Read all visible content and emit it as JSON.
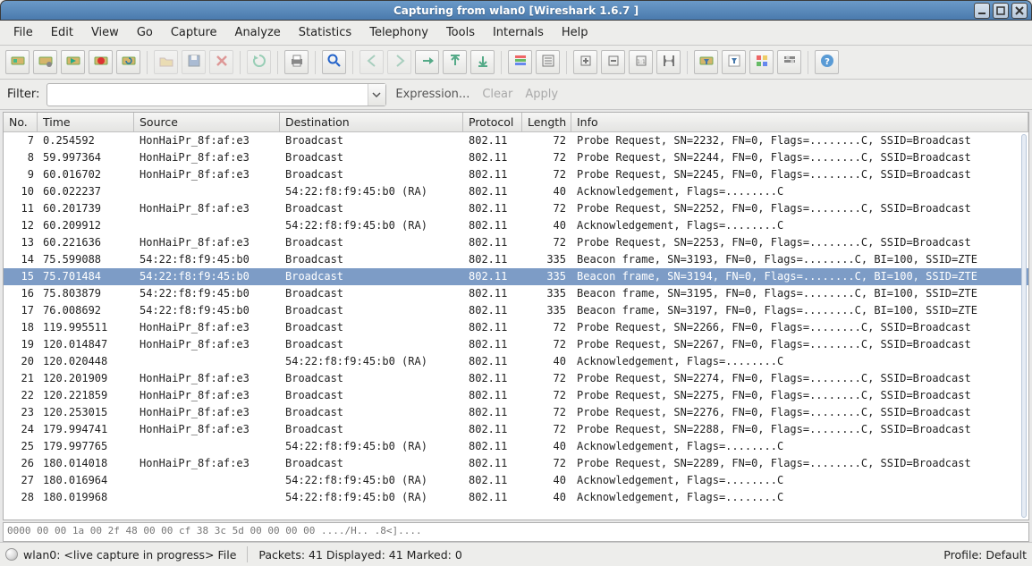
{
  "window_title": "Capturing from wlan0   [Wireshark 1.6.7 ]",
  "menu": {
    "file": "File",
    "edit": "Edit",
    "view": "View",
    "go": "Go",
    "capture": "Capture",
    "analyze": "Analyze",
    "statistics": "Statistics",
    "telephony": "Telephony",
    "tools": "Tools",
    "internals": "Internals",
    "help": "Help"
  },
  "filter": {
    "label": "Filter:",
    "value": "",
    "expression": "Expression...",
    "clear": "Clear",
    "apply": "Apply"
  },
  "columns": {
    "no": "No.",
    "time": "Time",
    "source": "Source",
    "dest": "Destination",
    "proto": "Protocol",
    "len": "Length",
    "info": "Info"
  },
  "selected_no": 15,
  "packets": [
    {
      "no": 7,
      "time": "0.254592",
      "src": "HonHaiPr_8f:af:e3",
      "dst": "Broadcast",
      "proto": "802.11",
      "len": 72,
      "info": "Probe Request, SN=2232, FN=0, Flags=........C, SSID=Broadcast"
    },
    {
      "no": 8,
      "time": "59.997364",
      "src": "HonHaiPr_8f:af:e3",
      "dst": "Broadcast",
      "proto": "802.11",
      "len": 72,
      "info": "Probe Request, SN=2244, FN=0, Flags=........C, SSID=Broadcast"
    },
    {
      "no": 9,
      "time": "60.016702",
      "src": "HonHaiPr_8f:af:e3",
      "dst": "Broadcast",
      "proto": "802.11",
      "len": 72,
      "info": "Probe Request, SN=2245, FN=0, Flags=........C, SSID=Broadcast"
    },
    {
      "no": 10,
      "time": "60.022237",
      "src": "",
      "dst": "54:22:f8:f9:45:b0 (RA)",
      "proto": "802.11",
      "len": 40,
      "info": "Acknowledgement, Flags=........C"
    },
    {
      "no": 11,
      "time": "60.201739",
      "src": "HonHaiPr_8f:af:e3",
      "dst": "Broadcast",
      "proto": "802.11",
      "len": 72,
      "info": "Probe Request, SN=2252, FN=0, Flags=........C, SSID=Broadcast"
    },
    {
      "no": 12,
      "time": "60.209912",
      "src": "",
      "dst": "54:22:f8:f9:45:b0 (RA)",
      "proto": "802.11",
      "len": 40,
      "info": "Acknowledgement, Flags=........C"
    },
    {
      "no": 13,
      "time": "60.221636",
      "src": "HonHaiPr_8f:af:e3",
      "dst": "Broadcast",
      "proto": "802.11",
      "len": 72,
      "info": "Probe Request, SN=2253, FN=0, Flags=........C, SSID=Broadcast"
    },
    {
      "no": 14,
      "time": "75.599088",
      "src": "54:22:f8:f9:45:b0",
      "dst": "Broadcast",
      "proto": "802.11",
      "len": 335,
      "info": "Beacon frame, SN=3193, FN=0, Flags=........C, BI=100, SSID=ZTE"
    },
    {
      "no": 15,
      "time": "75.701484",
      "src": "54:22:f8:f9:45:b0",
      "dst": "Broadcast",
      "proto": "802.11",
      "len": 335,
      "info": "Beacon frame, SN=3194, FN=0, Flags=........C, BI=100, SSID=ZTE"
    },
    {
      "no": 16,
      "time": "75.803879",
      "src": "54:22:f8:f9:45:b0",
      "dst": "Broadcast",
      "proto": "802.11",
      "len": 335,
      "info": "Beacon frame, SN=3195, FN=0, Flags=........C, BI=100, SSID=ZTE"
    },
    {
      "no": 17,
      "time": "76.008692",
      "src": "54:22:f8:f9:45:b0",
      "dst": "Broadcast",
      "proto": "802.11",
      "len": 335,
      "info": "Beacon frame, SN=3197, FN=0, Flags=........C, BI=100, SSID=ZTE"
    },
    {
      "no": 18,
      "time": "119.995511",
      "src": "HonHaiPr_8f:af:e3",
      "dst": "Broadcast",
      "proto": "802.11",
      "len": 72,
      "info": "Probe Request, SN=2266, FN=0, Flags=........C, SSID=Broadcast"
    },
    {
      "no": 19,
      "time": "120.014847",
      "src": "HonHaiPr_8f:af:e3",
      "dst": "Broadcast",
      "proto": "802.11",
      "len": 72,
      "info": "Probe Request, SN=2267, FN=0, Flags=........C, SSID=Broadcast"
    },
    {
      "no": 20,
      "time": "120.020448",
      "src": "",
      "dst": "54:22:f8:f9:45:b0 (RA)",
      "proto": "802.11",
      "len": 40,
      "info": "Acknowledgement, Flags=........C"
    },
    {
      "no": 21,
      "time": "120.201909",
      "src": "HonHaiPr_8f:af:e3",
      "dst": "Broadcast",
      "proto": "802.11",
      "len": 72,
      "info": "Probe Request, SN=2274, FN=0, Flags=........C, SSID=Broadcast"
    },
    {
      "no": 22,
      "time": "120.221859",
      "src": "HonHaiPr_8f:af:e3",
      "dst": "Broadcast",
      "proto": "802.11",
      "len": 72,
      "info": "Probe Request, SN=2275, FN=0, Flags=........C, SSID=Broadcast"
    },
    {
      "no": 23,
      "time": "120.253015",
      "src": "HonHaiPr_8f:af:e3",
      "dst": "Broadcast",
      "proto": "802.11",
      "len": 72,
      "info": "Probe Request, SN=2276, FN=0, Flags=........C, SSID=Broadcast"
    },
    {
      "no": 24,
      "time": "179.994741",
      "src": "HonHaiPr_8f:af:e3",
      "dst": "Broadcast",
      "proto": "802.11",
      "len": 72,
      "info": "Probe Request, SN=2288, FN=0, Flags=........C, SSID=Broadcast"
    },
    {
      "no": 25,
      "time": "179.997765",
      "src": "",
      "dst": "54:22:f8:f9:45:b0 (RA)",
      "proto": "802.11",
      "len": 40,
      "info": "Acknowledgement, Flags=........C"
    },
    {
      "no": 26,
      "time": "180.014018",
      "src": "HonHaiPr_8f:af:e3",
      "dst": "Broadcast",
      "proto": "802.11",
      "len": 72,
      "info": "Probe Request, SN=2289, FN=0, Flags=........C, SSID=Broadcast"
    },
    {
      "no": 27,
      "time": "180.016964",
      "src": "",
      "dst": "54:22:f8:f9:45:b0 (RA)",
      "proto": "802.11",
      "len": 40,
      "info": "Acknowledgement, Flags=........C"
    },
    {
      "no": 28,
      "time": "180.019968",
      "src": "",
      "dst": "54:22:f8:f9:45:b0 (RA)",
      "proto": "802.11",
      "len": 40,
      "info": "Acknowledgement, Flags=........C"
    }
  ],
  "hex_preview": "0000  00 00 1a 00 2f 48 00 00  cf 38 3c 5d 00 00 00 00   ..../H.. .8<]....",
  "status": {
    "iface": "wlan0: <live capture in progress> File",
    "mid": "Packets: 41 Displayed: 41 Marked: 0",
    "profile": "Profile: Default"
  },
  "toolbar_icons": [
    "interfaces",
    "capture-options",
    "start",
    "stop",
    "restart",
    "sep",
    "open",
    "save",
    "close",
    "sep",
    "reload",
    "sep",
    "print",
    "sep",
    "find",
    "sep",
    "go-back",
    "go-forward",
    "go-to",
    "go-first",
    "go-last",
    "sep",
    "colorize",
    "auto-scroll",
    "sep",
    "zoom-in",
    "zoom-out",
    "zoom-100",
    "resize-cols",
    "sep",
    "capture-filters",
    "display-filters",
    "coloring-rules",
    "preferences",
    "sep",
    "help"
  ]
}
